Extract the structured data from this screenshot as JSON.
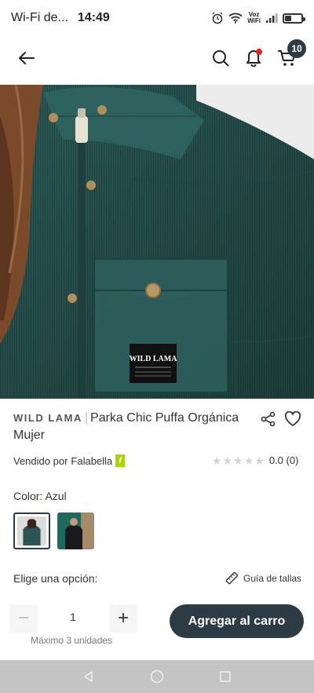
{
  "status_bar": {
    "network": "Wi-Fi de...",
    "time": "14:49",
    "voz_line1": "Voz",
    "voz_line2": "WiFi",
    "battery_level": 0.35
  },
  "nav": {
    "cart_count": "10",
    "icons": [
      "back-arrow-icon",
      "search-icon",
      "bell-icon",
      "cart-icon"
    ]
  },
  "carousel": {
    "total": 4,
    "active_index": 3,
    "patch_brand_text": "WILD LAMA"
  },
  "product": {
    "brand": "WILD LAMA",
    "separator": "|",
    "name": "Parka Chic Puffa Orgánica Mujer",
    "seller_prefix": "Vendido por",
    "seller": "Falabella",
    "seller_badge": "f",
    "rating_score": "0.0",
    "rating_count": "(0)",
    "stars_filled": 0,
    "stars_total": 5
  },
  "color": {
    "label": "Color: Azul",
    "swatches": [
      {
        "name": "Azul",
        "selected": true
      },
      {
        "name": "Verde",
        "selected": false
      }
    ]
  },
  "options": {
    "label": "Elige una opción:",
    "size_guide": "Guía de tallas"
  },
  "quantity": {
    "minus": "−",
    "value": "1",
    "plus": "+",
    "max_note": "Máximo 3 unidades"
  },
  "actions": {
    "add_to_cart": "Agregar al carro"
  },
  "colors": {
    "primary": "#2c3b44",
    "seller_badge": "#aad500",
    "jacket_green": "#2a5a57",
    "star_empty": "#d4d4d4"
  }
}
